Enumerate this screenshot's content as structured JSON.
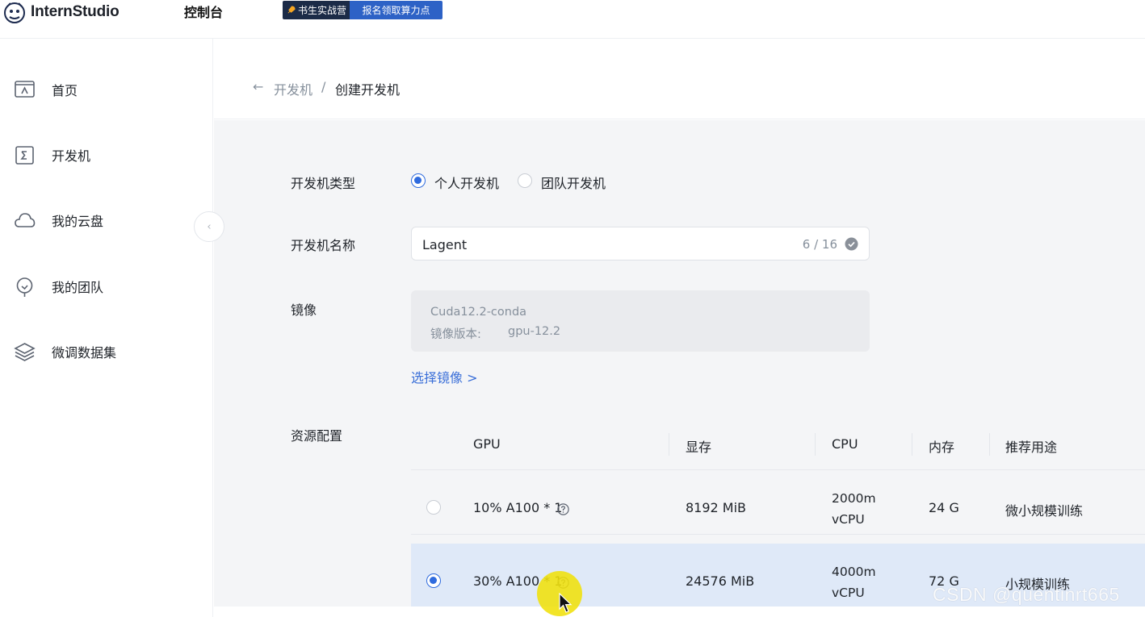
{
  "header": {
    "brand": "InternStudio",
    "console": "控制台",
    "promo_left": "书生实战营",
    "promo_right": "报名领取算力点"
  },
  "sidebar": {
    "items": [
      {
        "label": "首页",
        "icon": "home-icon"
      },
      {
        "label": "开发机",
        "icon": "terminal-icon"
      },
      {
        "label": "我的云盘",
        "icon": "cloud-icon"
      },
      {
        "label": "我的团队",
        "icon": "team-icon"
      },
      {
        "label": "微调数据集",
        "icon": "layers-icon"
      }
    ],
    "collapse": "‹"
  },
  "breadcrumb": {
    "back": "←",
    "parent": "开发机",
    "sep": "/",
    "current": "创建开发机"
  },
  "form": {
    "type_label": "开发机类型",
    "type_options": [
      {
        "label": "个人开发机",
        "checked": true
      },
      {
        "label": "团队开发机",
        "checked": false
      }
    ],
    "name_label": "开发机名称",
    "name_value": "Lagent",
    "name_count": "6 / 16",
    "image_label": "镜像",
    "image_name": "Cuda12.2-conda",
    "image_version_label": "镜像版本:",
    "image_version": "gpu-12.2",
    "select_image": "选择镜像 >",
    "resource_label": "资源配置"
  },
  "resources": {
    "headers": [
      "GPU",
      "显存",
      "CPU",
      "内存",
      "推荐用途"
    ],
    "rows": [
      {
        "gpu": "10% A100 * 1",
        "memory": "8192 MiB",
        "cpu_line1": "2000m",
        "cpu_line2": "vCPU",
        "ram": "24 G",
        "usage": "微小规模训练",
        "selected": false
      },
      {
        "gpu": "30% A100 * 1",
        "memory": "24576 MiB",
        "cpu_line1": "4000m",
        "cpu_line2": "vCPU",
        "ram": "72 G",
        "usage": "小规模训练",
        "selected": true
      }
    ]
  },
  "watermark": "CSDN @quentinrt665",
  "colors": {
    "accent": "#2f6bde",
    "link": "#3a6fd8",
    "selected_row": "#dfe9f8",
    "form_bg": "#f4f5f7"
  }
}
